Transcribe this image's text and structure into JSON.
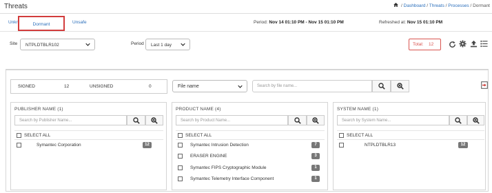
{
  "header": {
    "title": "Threats",
    "breadcrumb": [
      "Dashboard",
      "Threats",
      "Processes",
      "Dormant"
    ]
  },
  "tabs": [
    "Unknown",
    "Dormant",
    "Unsafe"
  ],
  "period_info": {
    "label": "Period:",
    "value": "Nov 14 01:10 PM - Nov 15 01:10 PM"
  },
  "refresh_info": {
    "label": "Refreshed at:",
    "value": "Nov 15 01:10 PM"
  },
  "filters": {
    "site_label": "Site",
    "site_value": "NTPLDTBLR102",
    "period_label": "Period",
    "period_value": "Last 1 day",
    "total_label": "Total:",
    "total_value": "12"
  },
  "summary": {
    "signed_label": "SIGNED",
    "signed_count": "12",
    "unsigned_label": "UNSIGNED",
    "unsigned_count": "0"
  },
  "file_filter": {
    "value": "File name",
    "placeholder": "Search by file name..."
  },
  "columns": {
    "publisher": {
      "title": "PUBLISHER NAME (1)",
      "placeholder": "Search by Publisher Name...",
      "select_all": "SELECT ALL",
      "items": [
        {
          "name": "Symantec Corporation",
          "count": "12"
        }
      ]
    },
    "product": {
      "title": "PRODUCT NAME (4)",
      "placeholder": "Search by Product Name...",
      "select_all": "SELECT ALL",
      "items": [
        {
          "name": "Symantec Intrusion Detection",
          "count": "7"
        },
        {
          "name": "ERASER ENGINE",
          "count": "3"
        },
        {
          "name": "Symantec FIPS Cryptographic Module",
          "count": "1"
        },
        {
          "name": "Symantec Telemetry Interface Component",
          "count": "1"
        }
      ]
    },
    "system": {
      "title": "SYSTEM NAME (1)",
      "placeholder": "Search by System Name...",
      "select_all": "SELECT ALL",
      "items": [
        {
          "name": "NTPLDTBLR13",
          "count": "12"
        }
      ]
    }
  },
  "colors": {
    "link": "#2a6ebb",
    "danger": "#d9534f",
    "badge": "#777777"
  },
  "icons": [
    "home-icon",
    "chevron-down-icon",
    "refresh-icon",
    "gear-icon",
    "upload-icon",
    "list-settings-icon",
    "search-icon",
    "clear-search-icon",
    "export-icon"
  ]
}
